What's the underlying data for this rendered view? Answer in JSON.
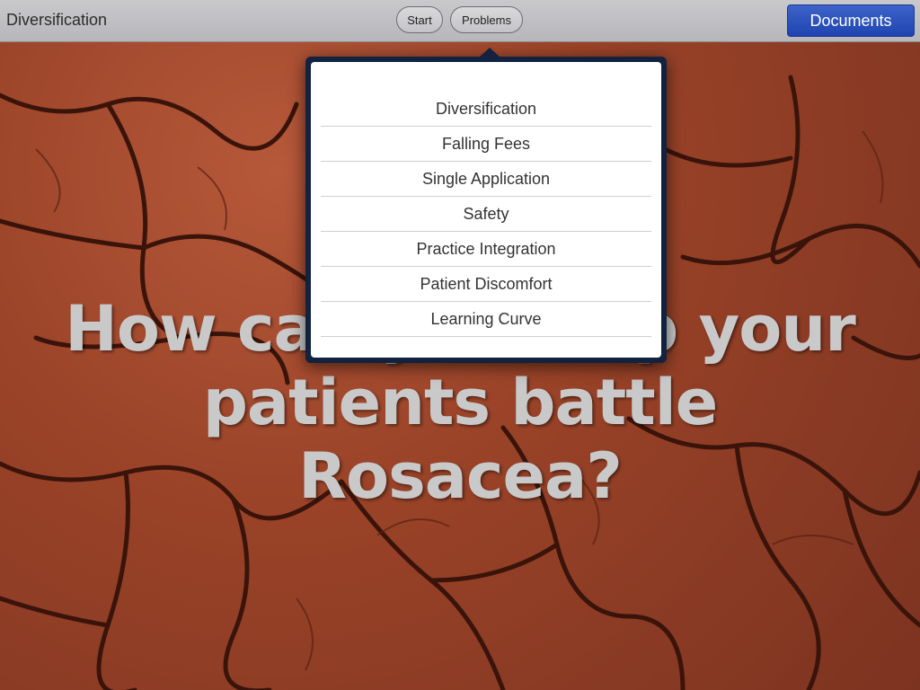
{
  "topbar": {
    "title": "Diversification",
    "start_label": "Start",
    "problems_label": "Problems",
    "documents_label": "Documents"
  },
  "headline": {
    "line1": "How can you help your",
    "line2": "patients battle Rosacea?"
  },
  "popover": {
    "items": [
      "Diversification",
      "Falling Fees",
      "Single Application",
      "Safety",
      "Practice Integration",
      "Patient Discomfort",
      "Learning Curve"
    ]
  },
  "colors": {
    "documents_button": "#2447b3",
    "popover_frame": "#12223f",
    "background": "#9a4328"
  }
}
